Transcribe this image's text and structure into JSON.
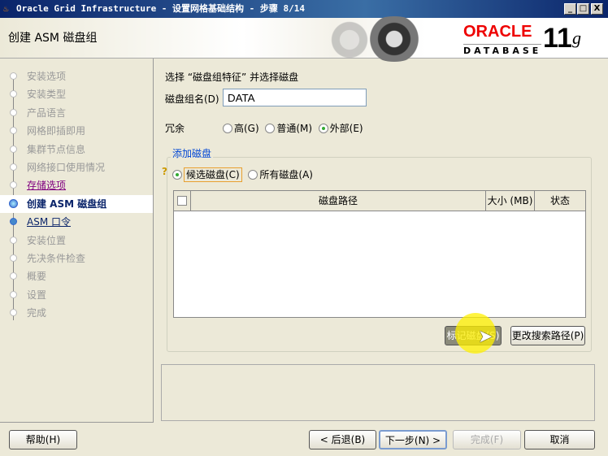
{
  "window": {
    "title": "Oracle Grid Infrastructure - 设置网格基础结构 - 步骤 8/14",
    "minimize": "_",
    "maximize": "□",
    "close": "X"
  },
  "header": {
    "title": "创建 ASM 磁盘组",
    "brand": "ORACLE",
    "product": "DATABASE",
    "version": "11",
    "version_suffix": "g"
  },
  "sidebar": {
    "items": [
      {
        "label": "安装选项",
        "state": "done"
      },
      {
        "label": "安装类型",
        "state": "done"
      },
      {
        "label": "产品语言",
        "state": "done"
      },
      {
        "label": "网格即插即用",
        "state": "done"
      },
      {
        "label": "集群节点信息",
        "state": "done"
      },
      {
        "label": "网络接口使用情况",
        "state": "done"
      },
      {
        "label": "存储选项",
        "state": "visited"
      },
      {
        "label": "创建 ASM 磁盘组",
        "state": "current"
      },
      {
        "label": "ASM 口令",
        "state": "next"
      },
      {
        "label": "安装位置",
        "state": "pending"
      },
      {
        "label": "先决条件检查",
        "state": "pending"
      },
      {
        "label": "概要",
        "state": "pending"
      },
      {
        "label": "设置",
        "state": "pending"
      },
      {
        "label": "完成",
        "state": "pending"
      }
    ]
  },
  "main": {
    "instruction": "选择 “磁盘组特征” 并选择磁盘",
    "diskgroup_label": "磁盘组名(D)",
    "diskgroup_value": "DATA",
    "redundancy_label": "冗余",
    "redundancy_options": [
      {
        "label": "高(G)",
        "selected": false
      },
      {
        "label": "普通(M)",
        "selected": false
      },
      {
        "label": "外部(E)",
        "selected": true
      }
    ],
    "add_disks": {
      "legend": "添加磁盘",
      "filter_options": [
        {
          "label": "候选磁盘(C)",
          "selected": true
        },
        {
          "label": "所有磁盘(A)",
          "selected": false
        }
      ],
      "columns": [
        "磁盘路径",
        "大小 (MB)",
        "状态"
      ],
      "stamp_button": "标记磁盘(S)",
      "change_path_button": "更改搜索路径(P)"
    }
  },
  "footer": {
    "help": "帮助(H)",
    "back": "< 后退(B)",
    "next": "下一步(N) >",
    "finish": "完成(F)",
    "cancel": "取消"
  }
}
